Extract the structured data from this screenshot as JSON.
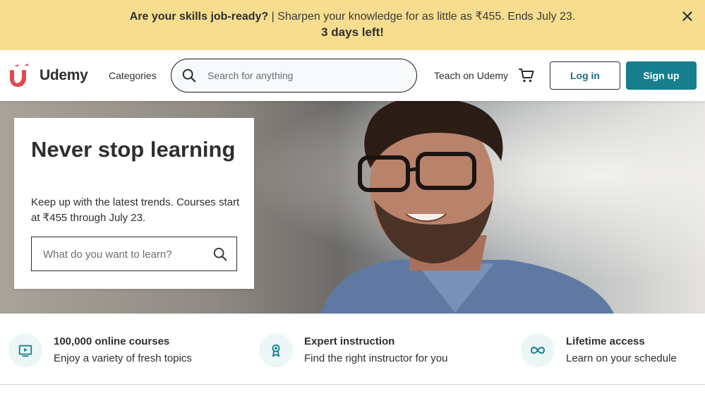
{
  "promo": {
    "headline": "Are your skills job-ready?",
    "separator": " | ",
    "body": "Sharpen your knowledge for as little as ₹455. Ends July 23.",
    "countdown": "3 days left!"
  },
  "header": {
    "logo_text": "Udemy",
    "categories_label": "Categories",
    "search_placeholder": "Search for anything",
    "teach_label": "Teach on Udemy",
    "login_label": "Log in",
    "signup_label": "Sign up"
  },
  "hero": {
    "title": "Never stop learning",
    "subtitle": "Keep up with the latest trends. Courses start at ₹455 through July 23.",
    "search_placeholder": "What do you want to learn?"
  },
  "features": [
    {
      "title": "100,000 online courses",
      "text": "Enjoy a variety of fresh topics",
      "icon": "video-play-icon"
    },
    {
      "title": "Expert instruction",
      "text": "Find the right instructor for you",
      "icon": "award-ribbon-icon"
    },
    {
      "title": "Lifetime access",
      "text": "Learn on your schedule",
      "icon": "infinity-icon"
    }
  ],
  "colors": {
    "promo_bg": "#f7dd8f",
    "brand_red": "#a435f0",
    "logo_red": "#e3484e",
    "signup_bg": "#167e8d",
    "login_text": "#1f6f86",
    "feature_icon_bg": "#edf6f6",
    "feature_icon_fg": "#167e8d"
  }
}
